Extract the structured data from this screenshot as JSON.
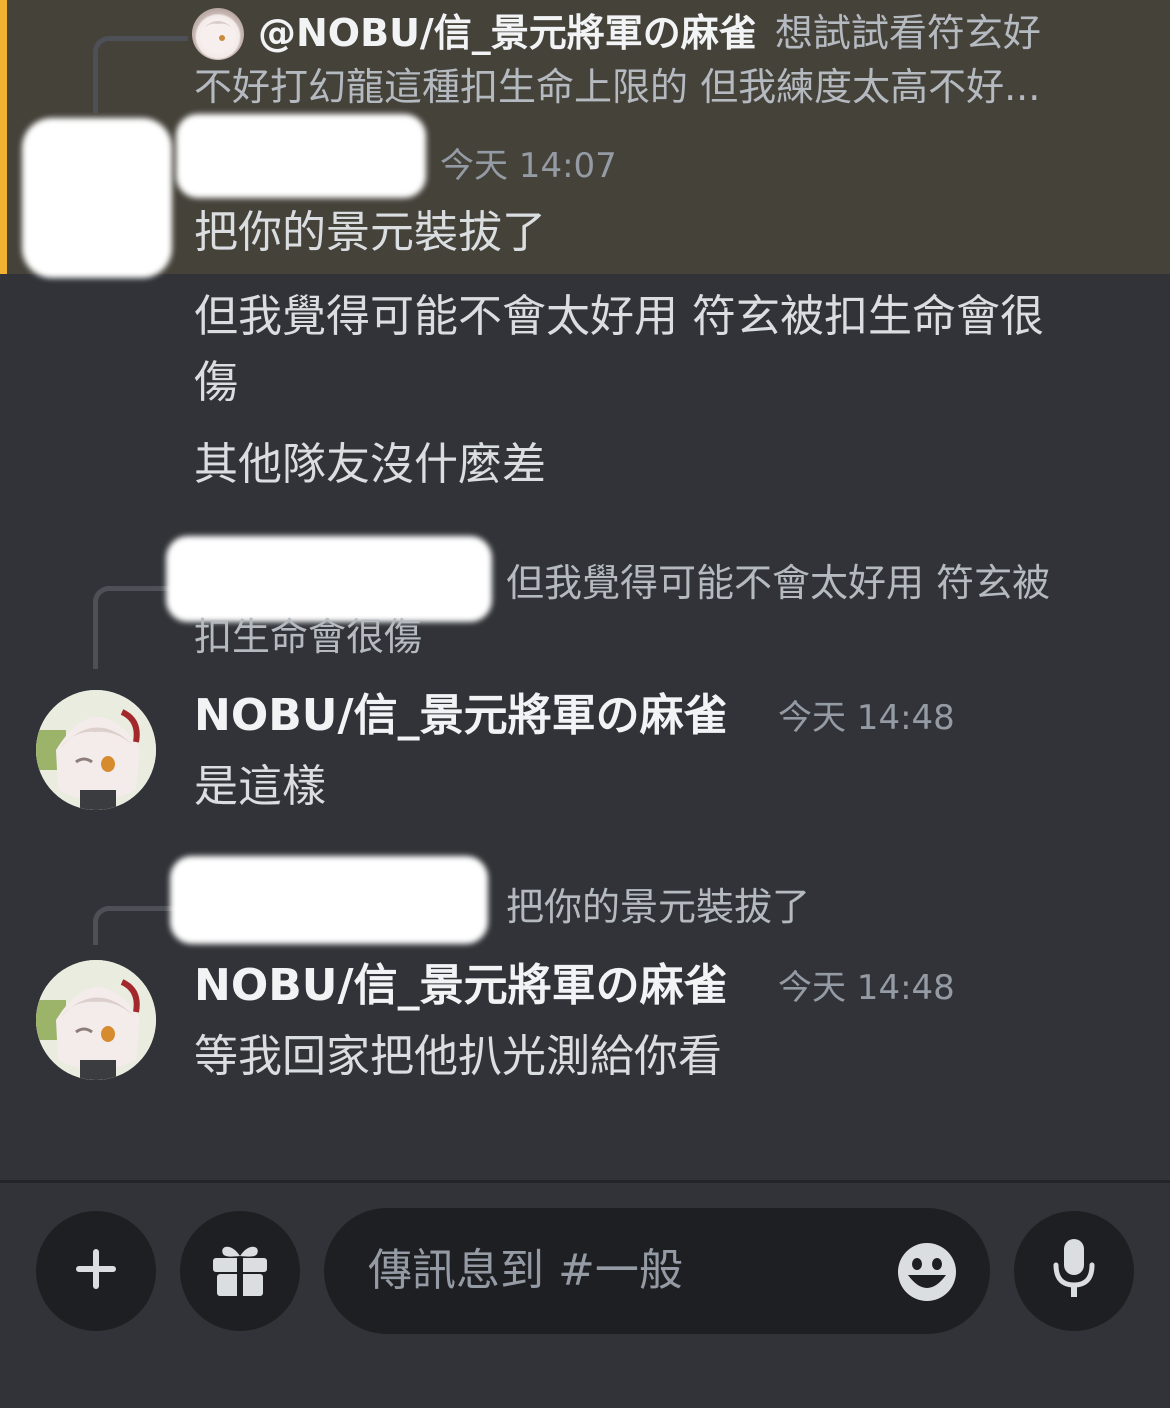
{
  "mention_reply": {
    "author": "@NOBU/信_景元將軍の麻雀",
    "preview_line1": "想試試看符玄好",
    "preview_line2": "不好打幻龍這種扣生命上限的 但我練度太高不好..."
  },
  "message_group_1": {
    "timestamp": "今天 14:07",
    "messages": [
      "把你的景元裝拔了",
      "但我覺得可能不會太好用 符玄被扣生命會很",
      "傷",
      "其他隊友沒什麼差"
    ]
  },
  "message_group_2": {
    "reply_preview_line1": "但我覺得可能不會太好用 符玄被",
    "reply_preview_line2": "扣生命會很傷",
    "author": "NOBU/信_景元將軍の麻雀",
    "timestamp": "今天 14:48",
    "message": "是這樣"
  },
  "message_group_3": {
    "reply_preview": "把你的景元裝拔了",
    "author": "NOBU/信_景元將軍の麻雀",
    "timestamp": "今天 14:48",
    "message": "等我回家把他扒光測給你看"
  },
  "composer": {
    "placeholder": "傳訊息到 #一般",
    "add_icon": "plus-icon",
    "gift_icon": "gift-icon",
    "emoji_icon": "emoji-icon",
    "mic_icon": "microphone-icon"
  },
  "colors": {
    "background": "#313338",
    "mention_highlight": "#45423a",
    "mention_bar": "#f0b132",
    "input_background": "#1e1f22"
  }
}
